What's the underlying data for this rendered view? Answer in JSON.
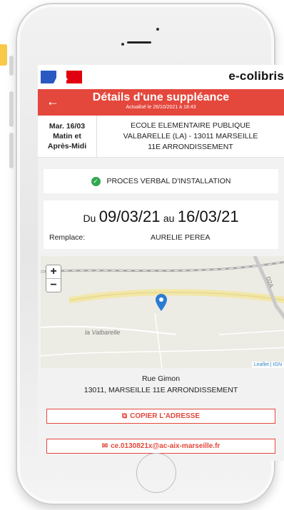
{
  "header": {
    "brand": "e-colibris",
    "title": "Détails d'une suppléance",
    "updated": "Actualisé le 26/10/2021 à 18:43",
    "back_icon": "back-arrow-icon"
  },
  "assignment": {
    "date": "Mar. 16/03",
    "time_1": "Matin et",
    "time_2": "Après-Midi",
    "school_line_1": "ECOLE ELEMENTAIRE PUBLIQUE",
    "school_line_2": "VALBARELLE (LA) - 13011 MARSEILLE",
    "school_line_3": "11E ARRONDISSEMENT"
  },
  "pv": {
    "label": "PROCES VERBAL D'INSTALLATION",
    "icon": "check-circle-icon",
    "color": "#2fa84f"
  },
  "period": {
    "from_prefix": "Du",
    "from": "09/03/21",
    "to_prefix": "au",
    "to": "16/03/21",
    "replaces_label": "Remplace:",
    "replaces_name": "AURELIE PEREA"
  },
  "map": {
    "zoom_in": "+",
    "zoom_out": "−",
    "place_label": "la Valbarelle",
    "road_label": "D2A",
    "attribution": "Leaflet | IGN",
    "marker_icon": "map-marker-icon"
  },
  "address": {
    "street": "Rue Gimon",
    "city": "13011, MARSEILLE 11E ARRONDISSEMENT"
  },
  "actions": {
    "copy_label": "COPIER L'ADRESSE",
    "email_label": "ce.0130821x@ac-aix-marseille.fr"
  },
  "colors": {
    "accent": "#e4473c",
    "flag_blue": "#2b59c3",
    "flag_red": "#e1000f"
  }
}
